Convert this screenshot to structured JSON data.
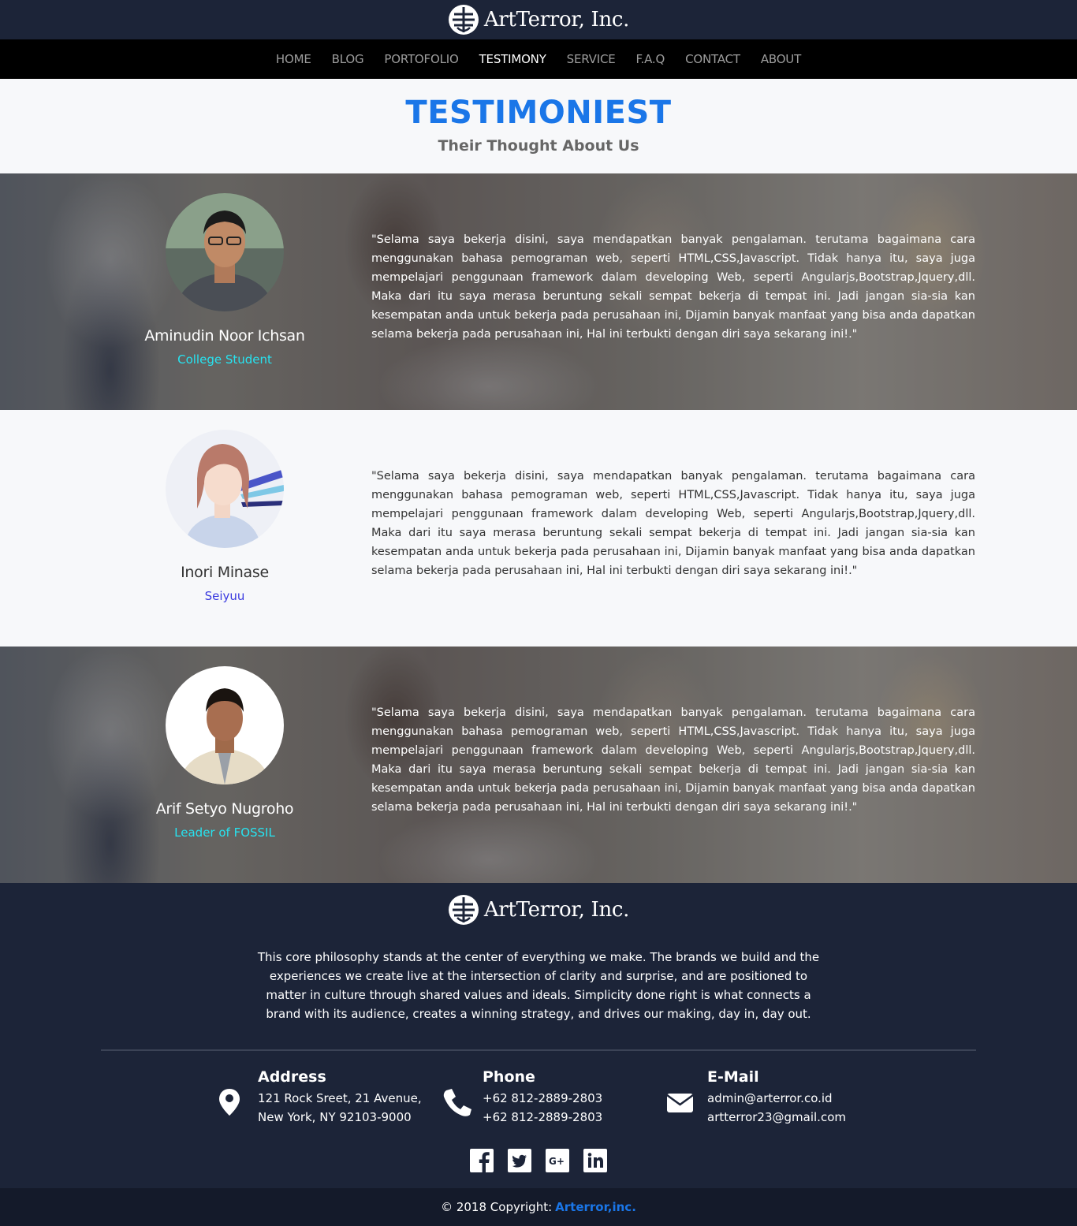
{
  "brand": {
    "name": "ArtTerror, Inc.",
    "logo_icon": "globe-logo-icon"
  },
  "nav": {
    "items": [
      {
        "label": "HOME"
      },
      {
        "label": "BLOG"
      },
      {
        "label": "PORTOFOLIO"
      },
      {
        "label": "TESTIMONY",
        "active": true
      },
      {
        "label": "SERVICE"
      },
      {
        "label": "F.A.Q"
      },
      {
        "label": "CONTACT"
      },
      {
        "label": "ABOUT"
      }
    ]
  },
  "section": {
    "title": "TESTIMONIEST",
    "subtitle": "Their Thought About Us"
  },
  "testimonials": [
    {
      "name": "Aminudin Noor Ichsan",
      "role": "College Student",
      "quote": "\"Selama saya bekerja disini, saya mendapatkan banyak pengalaman. terutama bagaimana cara menggunakan bahasa pemograman web, seperti HTML,CSS,Javascript. Tidak hanya itu, saya juga mempelajari penggunaan framework dalam developing Web, seperti Angularjs,Bootstrap,Jquery,dll. Maka dari itu saya merasa beruntung sekali sempat bekerja di tempat ini. Jadi jangan sia-sia kan kesempatan anda untuk bekerja pada perusahaan ini, Dijamin banyak manfaat yang bisa anda dapatkan selama bekerja pada perusahaan ini, Hal ini terbukti dengan diri saya sekarang ini!.\""
    },
    {
      "name": "Inori Minase",
      "role": "Seiyuu",
      "quote": "\"Selama saya bekerja disini, saya mendapatkan banyak pengalaman. terutama bagaimana cara menggunakan bahasa pemograman web, seperti HTML,CSS,Javascript. Tidak hanya itu, saya juga mempelajari penggunaan framework dalam developing Web, seperti Angularjs,Bootstrap,Jquery,dll. Maka dari itu saya merasa beruntung sekali sempat bekerja di tempat ini. Jadi jangan sia-sia kan kesempatan anda untuk bekerja pada perusahaan ini, Dijamin banyak manfaat yang bisa anda dapatkan selama bekerja pada perusahaan ini, Hal ini terbukti dengan diri saya sekarang ini!.\""
    },
    {
      "name": "Arif Setyo Nugroho",
      "role": "Leader of FOSSIL",
      "quote": "\"Selama saya bekerja disini, saya mendapatkan banyak pengalaman. terutama bagaimana cara menggunakan bahasa pemograman web, seperti HTML,CSS,Javascript. Tidak hanya itu, saya juga mempelajari penggunaan framework dalam developing Web, seperti Angularjs,Bootstrap,Jquery,dll. Maka dari itu saya merasa beruntung sekali sempat bekerja di tempat ini. Jadi jangan sia-sia kan kesempatan anda untuk bekerja pada perusahaan ini, Dijamin banyak manfaat yang bisa anda dapatkan selama bekerja pada perusahaan ini, Hal ini terbukti dengan diri saya sekarang ini!.\""
    }
  ],
  "footer": {
    "description": "This core philosophy stands at the center of everything we make. The brands we build and the experiences we create live at the intersection of clarity and surprise, and are positioned to matter in culture through shared values and ideals. Simplicity done right is what connects a brand with its audience, creates a winning strategy, and drives our making, day in, day out.",
    "address": {
      "title": "Address",
      "line1": "121 Rock Sreet, 21 Avenue,",
      "line2": "New York, NY 92103-9000",
      "icon": "map-marker-icon"
    },
    "phone": {
      "title": "Phone",
      "line1": "+62 812-2889-2803",
      "line2": "+62 812-2889-2803",
      "icon": "phone-icon"
    },
    "email": {
      "title": "E-Mail",
      "line1": "admin@arterror.co.id",
      "line2": "artterror23@gmail.com",
      "icon": "envelope-icon"
    },
    "social_icons": [
      "facebook-icon",
      "twitter-icon",
      "google-plus-icon",
      "linkedin-icon"
    ],
    "copyright": "© 2018 Copyright:",
    "copyright_brand": "Arterror,inc."
  },
  "colors": {
    "accent": "#1a76e8",
    "dark": "#1c2438",
    "cyan_role": "#27e3f0",
    "blue_role": "#3a3adf"
  }
}
